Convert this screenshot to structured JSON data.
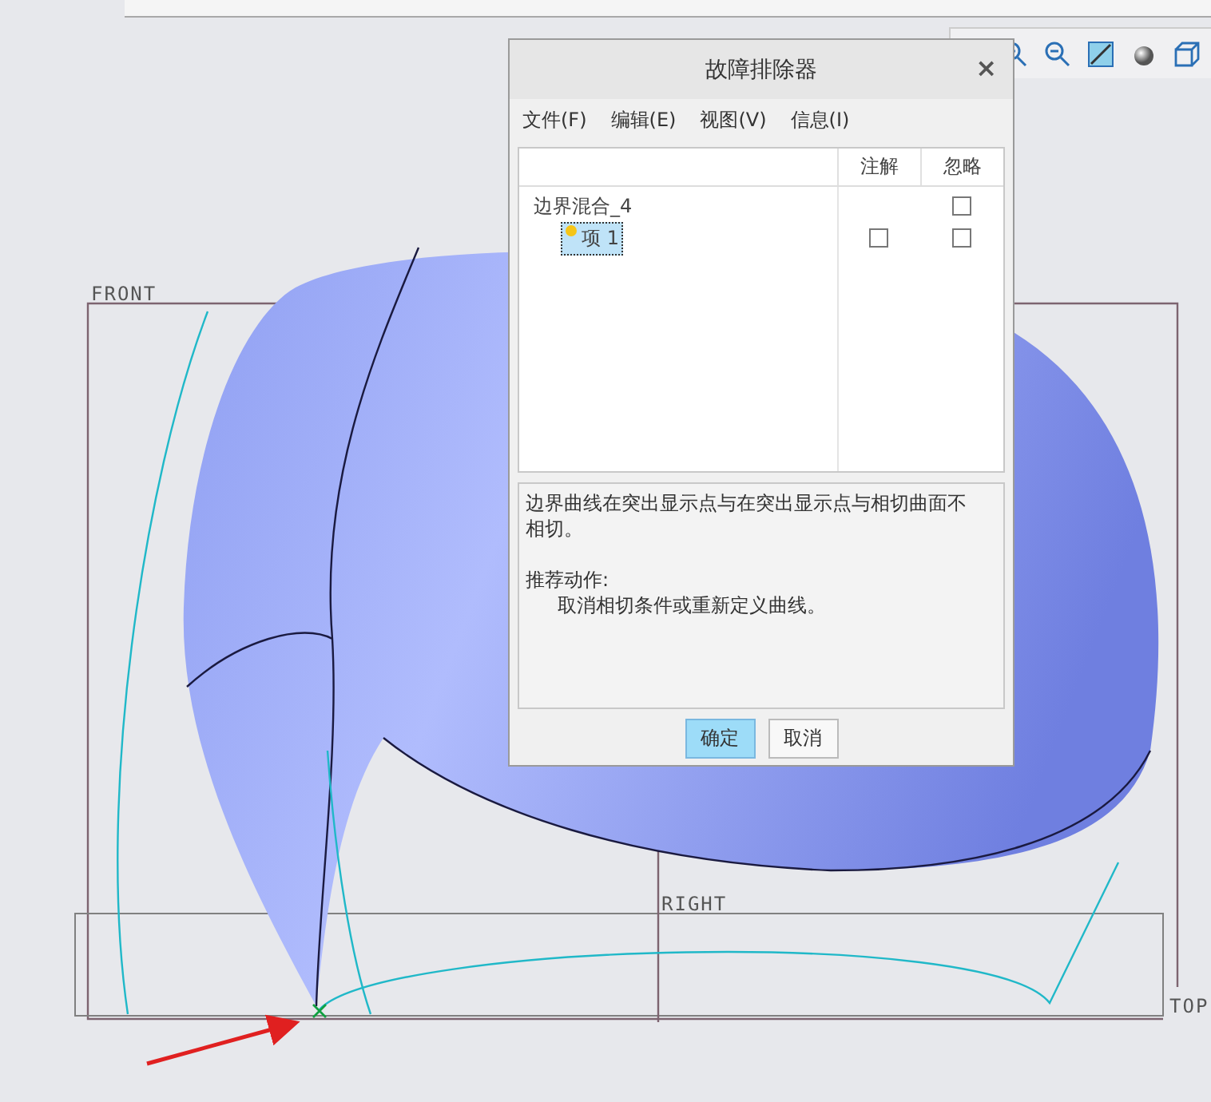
{
  "viewport": {
    "datum_labels": [
      {
        "kind": "front",
        "text": "FRONT"
      },
      {
        "kind": "right",
        "text": "RIGHT"
      },
      {
        "kind": "top",
        "text": "TOP"
      }
    ]
  },
  "dialog": {
    "title": "故障排除器",
    "close": "×",
    "menu": [
      "文件(F)",
      "编辑(E)",
      "视图(V)",
      "信息(I)"
    ],
    "columns": [
      "注解",
      "忽略"
    ],
    "tree": [
      {
        "label": "边界混合_4",
        "selected": false,
        "ignore_checked": false,
        "children": [
          {
            "label": "项 1",
            "selected": true,
            "annotate_checked": false,
            "ignore_checked": false
          }
        ]
      }
    ],
    "message": "边界曲线在突出显示点与在突出显示点与相切曲面不相切。",
    "action_heading": "推荐动作:",
    "action": "取消相切条件或重新定义曲线。",
    "buttons": [
      {
        "label": "确定",
        "selected": true
      },
      {
        "label": "取消",
        "selected": false
      }
    ]
  }
}
